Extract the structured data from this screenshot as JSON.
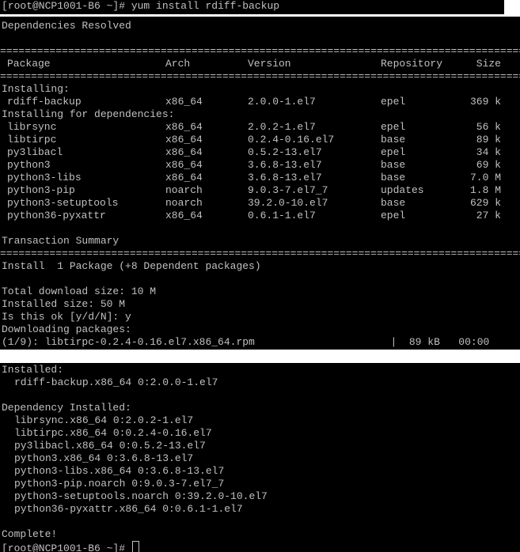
{
  "prompt_top": "[root@NCP1001-B6 ~]# yum install rdiff-backup",
  "deps_resolved": "Dependencies Resolved",
  "rule_eq": "==============================================================================================",
  "table": {
    "headers": [
      "Package",
      "Arch",
      "Version",
      "Repository",
      "Size"
    ],
    "installing_label": "Installing:",
    "main_package": {
      "name": "rdiff-backup",
      "arch": "x86_64",
      "version": "2.0.0-1.el7",
      "repo": "epel",
      "size": "369 k"
    },
    "deps_label": "Installing for dependencies:",
    "deps": [
      {
        "name": "librsync",
        "arch": "x86_64",
        "version": "2.0.2-1.el7",
        "repo": "epel",
        "size": "56 k"
      },
      {
        "name": "libtirpc",
        "arch": "x86_64",
        "version": "0.2.4-0.16.el7",
        "repo": "base",
        "size": "89 k"
      },
      {
        "name": "py3libacl",
        "arch": "x86_64",
        "version": "0.5.2-13.el7",
        "repo": "epel",
        "size": "34 k"
      },
      {
        "name": "python3",
        "arch": "x86_64",
        "version": "3.6.8-13.el7",
        "repo": "base",
        "size": "69 k"
      },
      {
        "name": "python3-libs",
        "arch": "x86_64",
        "version": "3.6.8-13.el7",
        "repo": "base",
        "size": "7.0 M"
      },
      {
        "name": "python3-pip",
        "arch": "noarch",
        "version": "9.0.3-7.el7_7",
        "repo": "updates",
        "size": "1.8 M"
      },
      {
        "name": "python3-setuptools",
        "arch": "noarch",
        "version": "39.2.0-10.el7",
        "repo": "base",
        "size": "629 k"
      },
      {
        "name": "python36-pyxattr",
        "arch": "x86_64",
        "version": "0.6.1-1.el7",
        "repo": "epel",
        "size": "27 k"
      }
    ]
  },
  "transaction_summary": "Transaction Summary",
  "install_line": "Install  1 Package (+8 Dependent packages)",
  "total_download": "Total download size: 10 M",
  "installed_size": "Installed size: 50 M",
  "confirm_prompt": "Is this ok [y/d/N]: y",
  "downloading": "Downloading packages:",
  "download_row": "(1/9): libtirpc-0.2.4-0.16.el7.x86_64.rpm                      |  89 kB   00:00",
  "installed_label": "Installed:",
  "installed_items": [
    "rdiff-backup.x86_64 0:2.0.0-1.el7"
  ],
  "dep_installed_label": "Dependency Installed:",
  "dep_installed_items": [
    "librsync.x86_64 0:2.0.2-1.el7",
    "libtirpc.x86_64 0:0.2.4-0.16.el7",
    "py3libacl.x86_64 0:0.5.2-13.el7",
    "python3.x86_64 0:3.6.8-13.el7",
    "python3-libs.x86_64 0:3.6.8-13.el7",
    "python3-pip.noarch 0:9.0.3-7.el7_7",
    "python3-setuptools.noarch 0:39.2.0-10.el7",
    "python36-pyxattr.x86_64 0:0.6.1-1.el7"
  ],
  "complete": "Complete!",
  "prompt_bottom": "[root@NCP1001-B6 ~]# ",
  "colors": {
    "terminal_bg": "#000000",
    "terminal_fg": "#c0c0c0",
    "separator": "#ffffff"
  }
}
